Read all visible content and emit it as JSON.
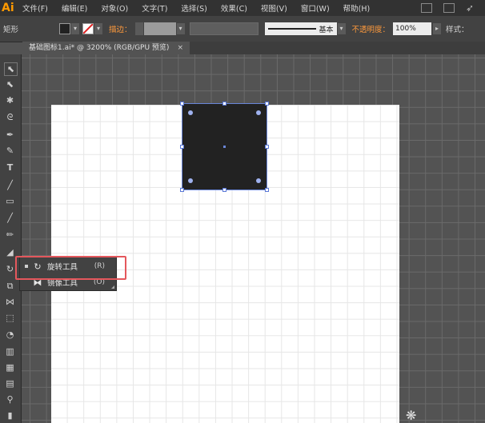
{
  "app": {
    "logo": "Ai"
  },
  "menu": {
    "items": [
      "文件(F)",
      "编辑(E)",
      "对象(O)",
      "文字(T)",
      "选择(S)",
      "效果(C)",
      "视图(V)",
      "窗口(W)",
      "帮助(H)"
    ]
  },
  "control_bar": {
    "tool_label": "矩形",
    "fill_color": "#222222",
    "stroke_label": "描边：",
    "stroke_style": "基本",
    "opacity_label": "不透明度：",
    "opacity_value": "100%",
    "style_label": "样式："
  },
  "document_tab": {
    "title": "基础图标1.ai* @ 3200% (RGB/GPU 预览)",
    "close": "×"
  },
  "flyout": {
    "items": [
      {
        "label": "旋转工具",
        "shortcut": "(R)",
        "icon": "rotate-icon",
        "active": true
      },
      {
        "label": "镜像工具",
        "shortcut": "(O)",
        "icon": "reflect-icon",
        "active": false
      }
    ]
  },
  "colors": {
    "accent_orange": "#ff9a3c",
    "selection_blue": "#5a78d6",
    "highlight_red": "#e4575c"
  }
}
